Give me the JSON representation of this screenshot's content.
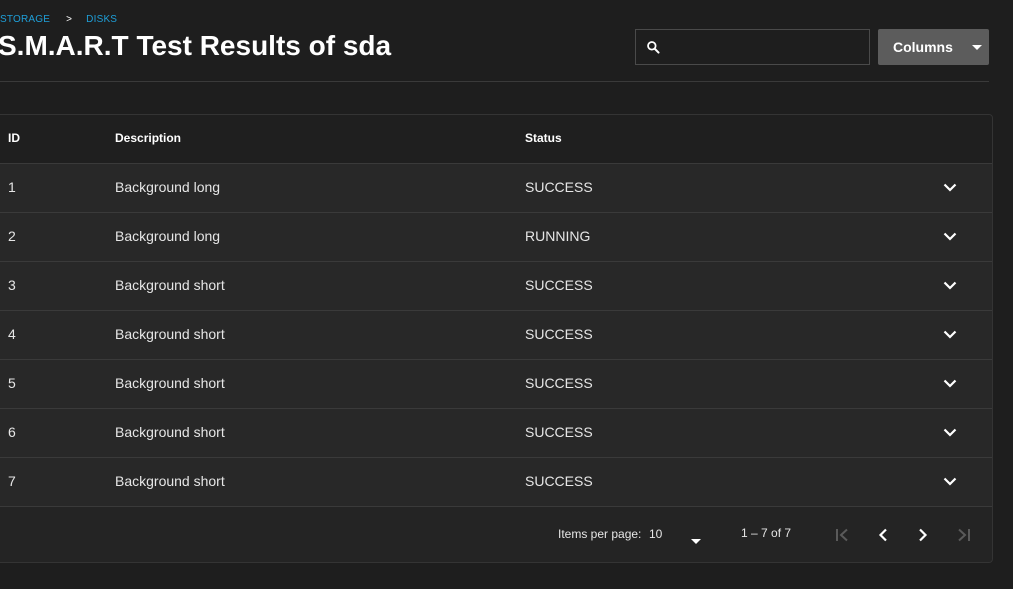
{
  "breadcrumb": {
    "items": [
      "STORAGE",
      "DISKS"
    ],
    "separator": ">"
  },
  "page": {
    "title": "S.M.A.R.T Test Results of sda"
  },
  "search": {
    "value": "",
    "placeholder": "",
    "icon": "search-icon"
  },
  "toolbar": {
    "columns_label": "Columns"
  },
  "table": {
    "headers": {
      "id": "ID",
      "description": "Description",
      "status": "Status"
    },
    "rows": [
      {
        "id": "1",
        "description": "Background long",
        "status": "SUCCESS"
      },
      {
        "id": "2",
        "description": "Background long",
        "status": "RUNNING"
      },
      {
        "id": "3",
        "description": "Background short",
        "status": "SUCCESS"
      },
      {
        "id": "4",
        "description": "Background short",
        "status": "SUCCESS"
      },
      {
        "id": "5",
        "description": "Background short",
        "status": "SUCCESS"
      },
      {
        "id": "6",
        "description": "Background short",
        "status": "SUCCESS"
      },
      {
        "id": "7",
        "description": "Background short",
        "status": "SUCCESS"
      }
    ]
  },
  "paginator": {
    "items_per_page_label": "Items per page:",
    "items_per_page_value": "10",
    "range_label": "1 – 7 of 7"
  },
  "colors": {
    "background": "#1e1e1e",
    "card": "#242424",
    "row": "#282828",
    "accent_link": "#1e9fd8",
    "button": "#5c5c5c",
    "divider": "#3a3a3a"
  }
}
